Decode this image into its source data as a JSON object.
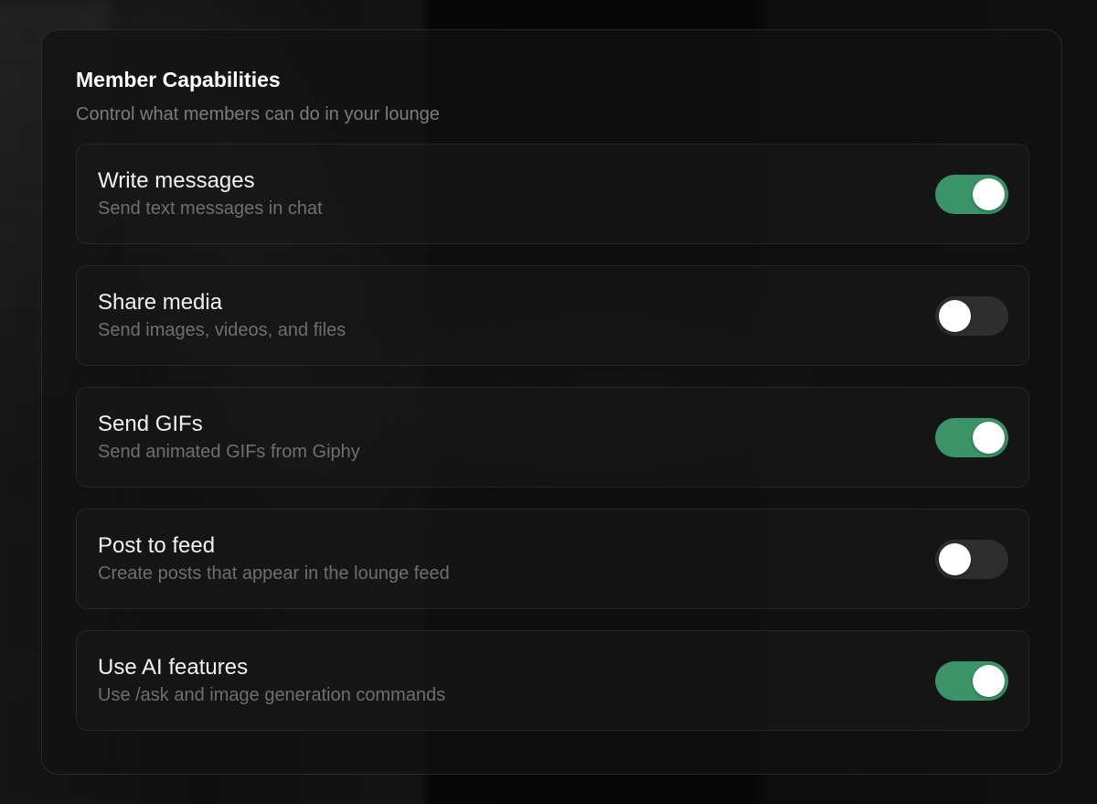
{
  "section": {
    "title": "Member Capabilities",
    "subtitle": "Control what members can do in your lounge"
  },
  "capabilities": [
    {
      "label": "Write messages",
      "description": "Send text messages in chat",
      "enabled": true
    },
    {
      "label": "Share media",
      "description": "Send images, videos, and files",
      "enabled": false
    },
    {
      "label": "Send GIFs",
      "description": "Send animated GIFs from Giphy",
      "enabled": true
    },
    {
      "label": "Post to feed",
      "description": "Create posts that appear in the lounge feed",
      "enabled": false
    },
    {
      "label": "Use AI features",
      "description": "Use /ask and image generation commands",
      "enabled": true
    }
  ],
  "colors": {
    "toggle_on": "#3a9467",
    "toggle_off": "#2e2e2e"
  }
}
